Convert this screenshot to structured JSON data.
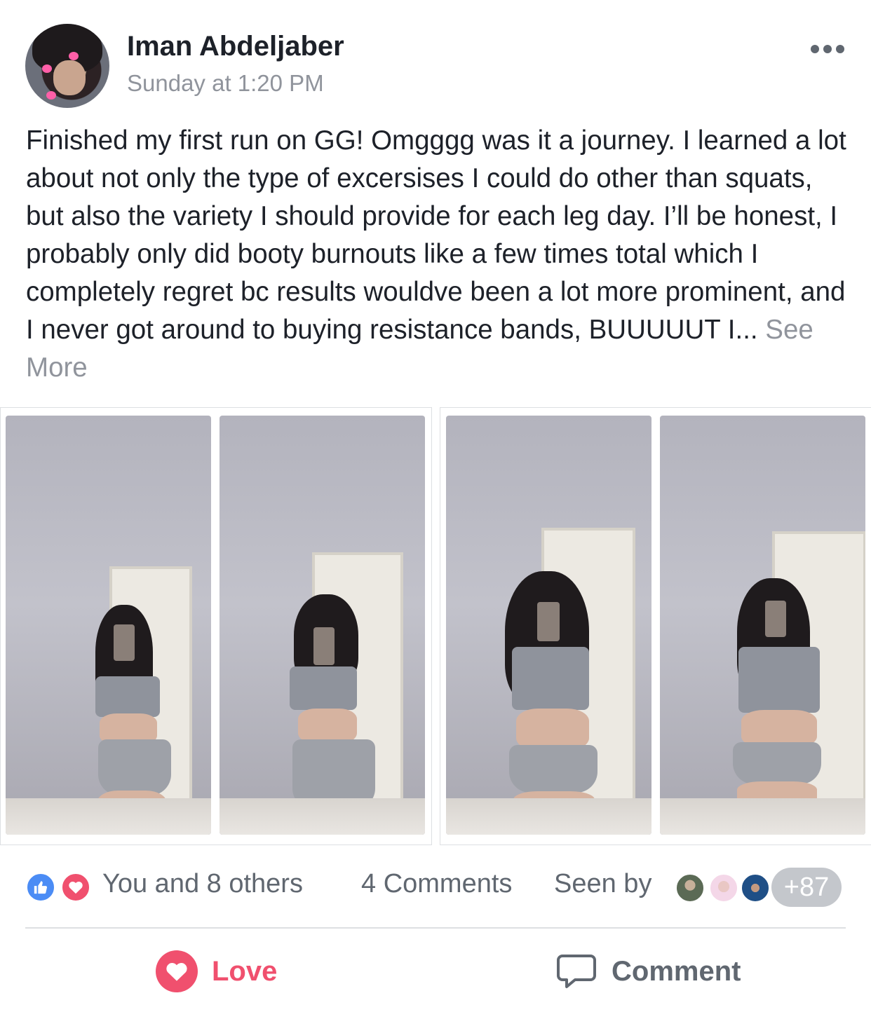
{
  "author": {
    "name": "Iman Abdeljaber",
    "timestamp": "Sunday at 1:20 PM"
  },
  "post": {
    "text": "Finished my first run on GG! Omgggg was it a journey. I learned a lot about not only the type of excersises I could do other than squats, but also the variety I should provide for each leg day. I’ll be honest, I probably only did booty burnouts like a few times total which I completely regret bc results wouldve been a lot more prominent, and I never got around to buying resistance bands, BUUUUUT I... ",
    "see_more": "See More"
  },
  "footer": {
    "reaction_summary": "You and 8 others",
    "comments_count": "4 Comments",
    "seen_by_label": "Seen by",
    "seen_more_count": "+87"
  },
  "actions": {
    "love_label": "Love",
    "comment_label": "Comment"
  },
  "icons": {
    "more": "more-options-icon",
    "like": "like-reaction-icon",
    "love": "love-reaction-icon",
    "comment": "comment-bubble-icon"
  },
  "colors": {
    "love": "#f0506e",
    "like": "#4b8cf5",
    "secondary_text": "#90949c"
  }
}
